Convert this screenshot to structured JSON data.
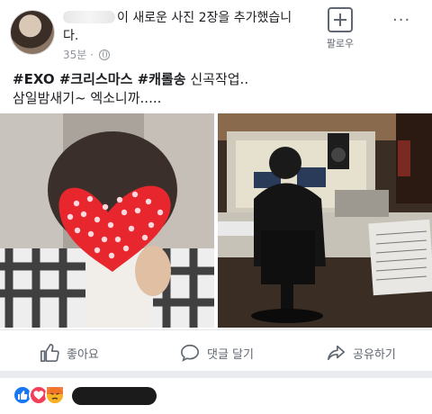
{
  "post": {
    "header_text": "이 새로운 사진 2장을 추가했습니다.",
    "time": "35분 · ",
    "follow_label": "팔로우",
    "more_label": "···",
    "caption_tags": "#EXO #크리스마스 #캐롤송",
    "caption_rest": " 신곡작업..",
    "caption_line2": "삼일밤새기~  엑소니까....."
  },
  "actions": {
    "like": "좋아요",
    "comment": "댓글 달기",
    "share": "공유하기"
  },
  "reactions": [
    "like",
    "love",
    "angry"
  ],
  "colors": {
    "like_blue": "#1877f2",
    "love_red": "#f33e58",
    "angry_yellow": "#f7b125",
    "heart_red": "#e8262e"
  }
}
